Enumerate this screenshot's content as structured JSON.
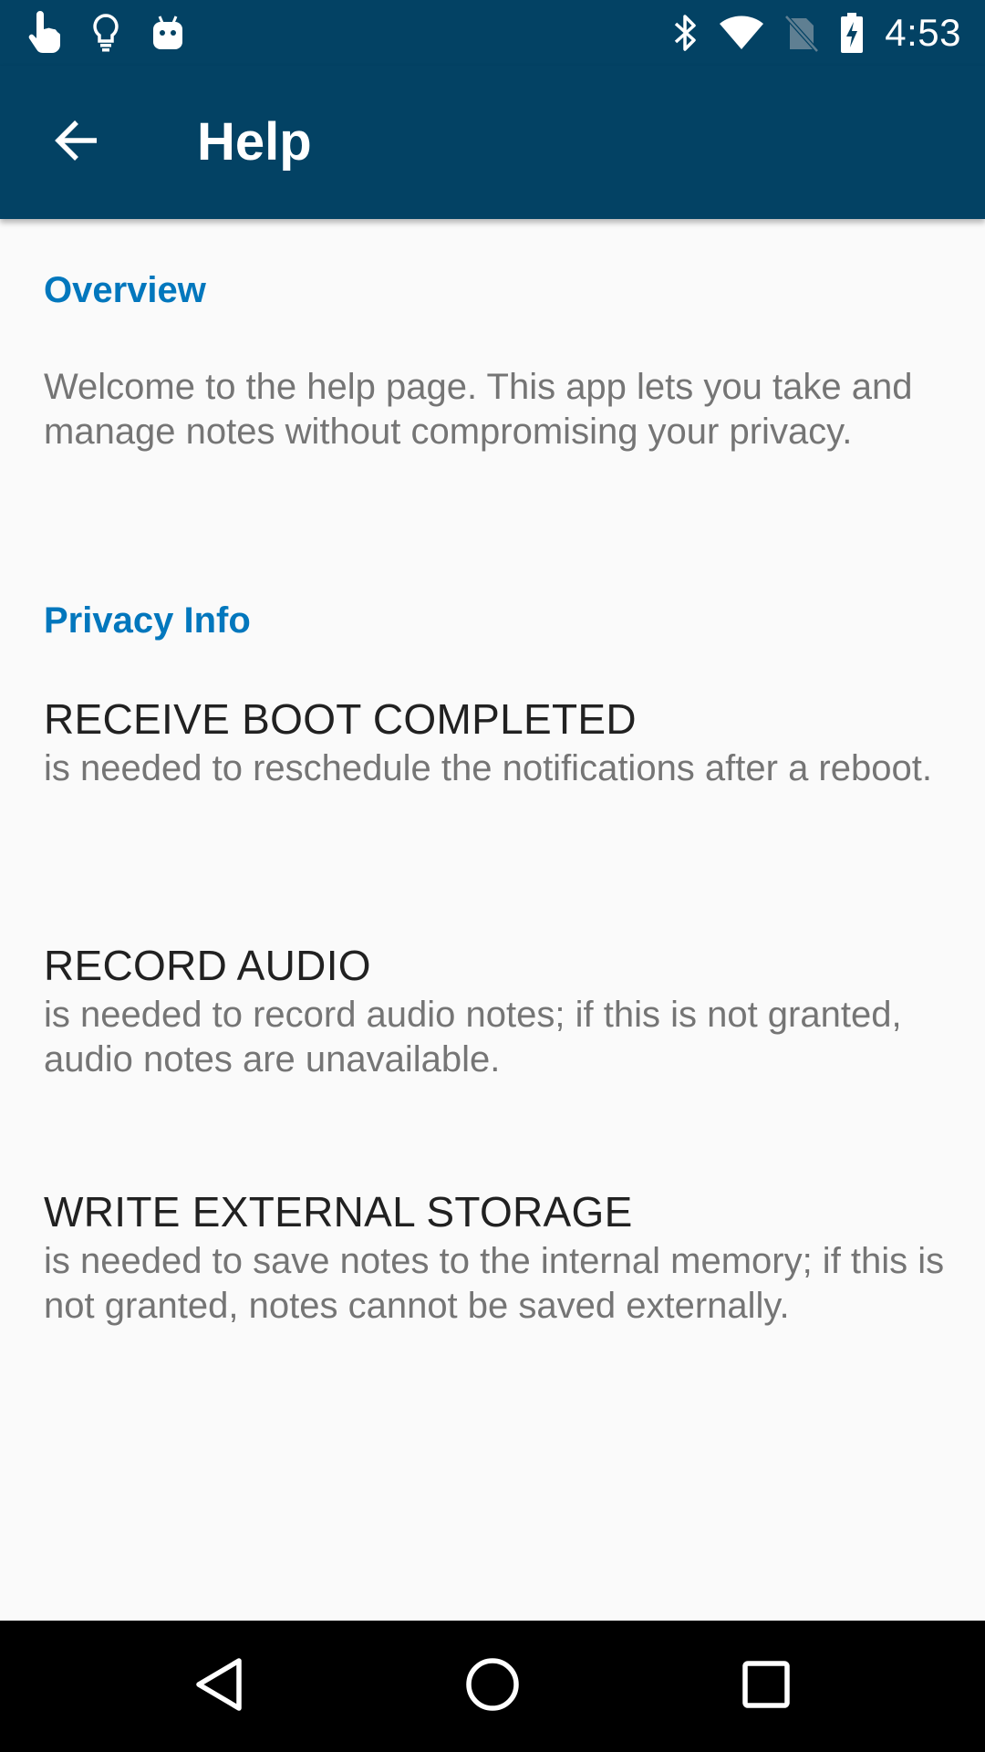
{
  "status_bar": {
    "time": "4:53",
    "left_icons": [
      "hand-pointer-icon",
      "lightbulb-icon",
      "android-icon"
    ],
    "right_icons": [
      "bluetooth-icon",
      "wifi-icon",
      "no-sim-icon",
      "battery-charging-icon"
    ]
  },
  "toolbar": {
    "title": "Help",
    "back_icon": "arrow-back-icon"
  },
  "colors": {
    "primary": "#034264",
    "accent": "#0277bd",
    "background": "#fafafa",
    "text_primary": "#212121",
    "text_secondary": "#757575"
  },
  "overview": {
    "header": "Overview",
    "text": "Welcome to the help page. This app lets you take and manage notes without compromising your privacy."
  },
  "privacy": {
    "header": "Privacy Info",
    "permissions": [
      {
        "name": "RECEIVE BOOT COMPLETED",
        "description": "is needed to reschedule the notifications after a reboot."
      },
      {
        "name": "RECORD AUDIO",
        "description": "is needed to record audio notes; if this is not granted, audio notes are unavailable."
      },
      {
        "name": "WRITE EXTERNAL STORAGE",
        "description": "is needed to save notes to the internal memory; if this is not granted, notes cannot be saved externally."
      }
    ]
  },
  "nav_bar": {
    "buttons": [
      "nav-back-icon",
      "nav-home-icon",
      "nav-recents-icon"
    ]
  }
}
